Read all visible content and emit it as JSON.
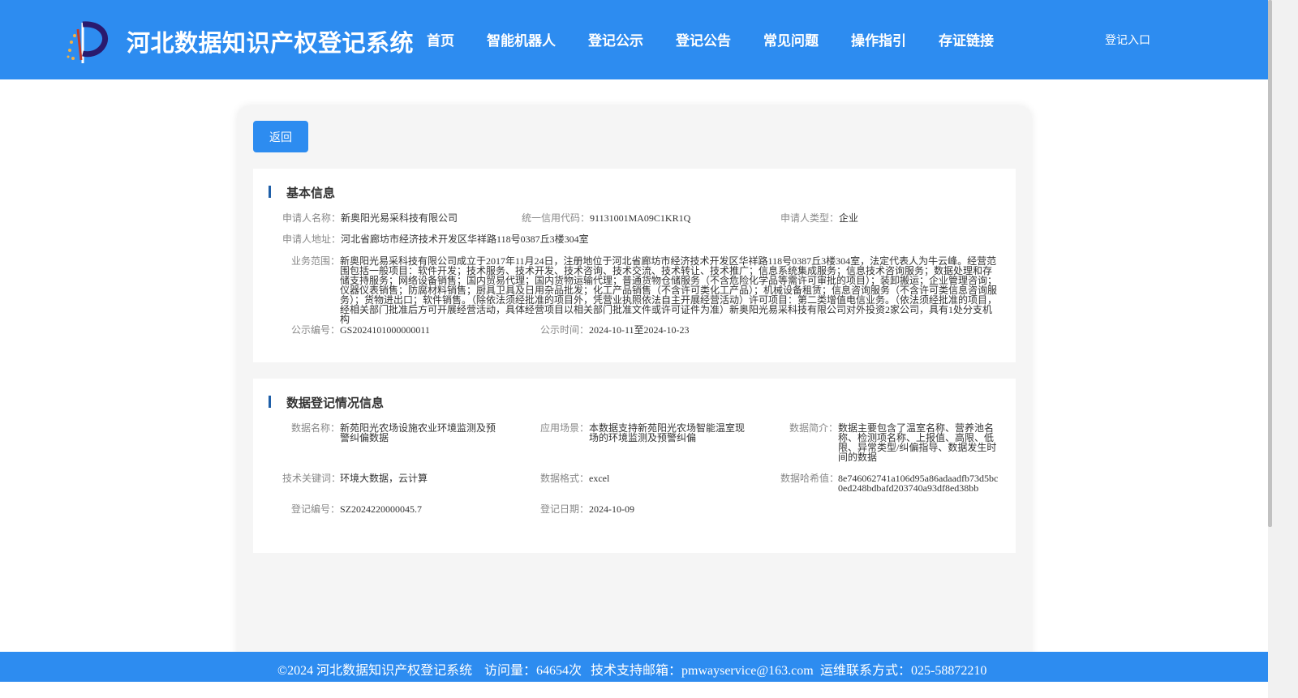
{
  "header": {
    "title": "河北数据知识产权登记系统",
    "nav": [
      "首页",
      "智能机器人",
      "登记公示",
      "登记公告",
      "常见问题",
      "操作指引",
      "存证链接"
    ],
    "login": "登记入口"
  },
  "back_label": "返回",
  "basic": {
    "title": "基本信息",
    "applicant_name": {
      "label": "申请人名称：",
      "value": "新奥阳光易采科技有限公司"
    },
    "credit_code": {
      "label": "统一信用代码：",
      "value": "91131001MA09C1KR1Q"
    },
    "applicant_type": {
      "label": "申请人类型：",
      "value": "企业"
    },
    "address": {
      "label": "申请人地址：",
      "value": "河北省廊坊市经济技术开发区华祥路118号0387丘3楼304室"
    },
    "scope": {
      "label": "业务范围：",
      "value": "新奥阳光易采科技有限公司成立于2017年11月24日，注册地位于河北省廊坊市经济技术开发区华祥路118号0387丘3楼304室，法定代表人为牛云峰。经营范围包括一般项目：软件开发；技术服务、技术开发、技术咨询、技术交流、技术转让、技术推广；信息系统集成服务；信息技术咨询服务；数据处理和存储支持服务；网络设备销售；国内贸易代理；国内货物运输代理；普通货物仓储服务（不含危险化学品等需许可审批的项目）；装卸搬运；企业管理咨询；仪器仪表销售；防腐材料销售；厨具卫具及日用杂品批发；化工产品销售（不含许可类化工产品）；机械设备租赁；信息咨询服务（不含许可类信息咨询服务）；货物进出口；软件销售。（除依法须经批准的项目外，凭营业执照依法自主开展经营活动）许可项目：第二类增值电信业务。（依法须经批准的项目，经相关部门批准后方可开展经营活动，具体经营项目以相关部门批准文件或许可证件为准）新奥阳光易采科技有限公司对外投资2家公司，具有1处分支机构"
    },
    "notice_no": {
      "label": "公示编号：",
      "value": "GS2024101000000011"
    },
    "notice_time": {
      "label": "公示时间：",
      "value": "2024-10-11至2024-10-23"
    }
  },
  "registration": {
    "title": "数据登记情况信息",
    "data_name": {
      "label": "数据名称：",
      "value": "新苑阳光农场设施农业环境监测及预警纠偏数据"
    },
    "scenario": {
      "label": "应用场景：",
      "value": "本数据支持新苑阳光农场智能温室现场的环境监测及预警纠偏"
    },
    "intro": {
      "label": "数据简介：",
      "value": "数据主要包含了温室名称、营养池名称、检测项名称、上报值、高限、低限、异常类型/纠偏指导、数据发生时间的数据"
    },
    "keywords": {
      "label": "技术关键词：",
      "value": "环境大数据，云计算"
    },
    "format": {
      "label": "数据格式：",
      "value": "excel"
    },
    "hash": {
      "label": "数据哈希值：",
      "value": "8e746062741a106d95a86adaadfb73d5bc0ed248bdbafd203740a93df8ed38bb"
    },
    "reg_no": {
      "label": "登记编号：",
      "value": "SZ2024220000045.7"
    },
    "reg_date": {
      "label": "登记日期：",
      "value": "2024-10-09"
    }
  },
  "footer": {
    "copyright": "©2024 河北数据知识产权登记系统",
    "visits": "访问量：64654次",
    "email": "技术支持邮箱：pmwayservice@163.com",
    "phone": "运维联系方式：025-58872210"
  },
  "colors": {
    "primary": "#2d8cf0",
    "accent_bar": "#1f5fa8"
  }
}
